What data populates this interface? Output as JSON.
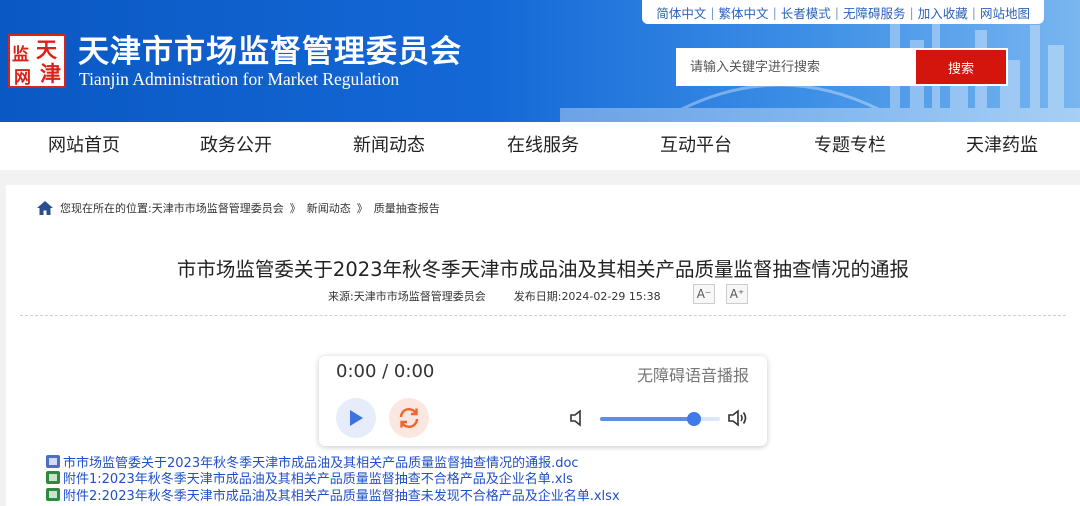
{
  "header": {
    "toplinks": [
      "简体中文",
      "繁体中文",
      "长者模式",
      "无障碍服务",
      "加入收藏",
      "网站地图"
    ],
    "logo_chars": [
      "天",
      "津",
      "监",
      "网"
    ],
    "site_title": "天津市市场监督管理委员会",
    "site_subtitle": "Tianjin Administration for Market Regulation",
    "search_placeholder": "请输入关键字进行搜索",
    "search_button": "搜索"
  },
  "nav": [
    "网站首页",
    "政务公开",
    "新闻动态",
    "在线服务",
    "互动平台",
    "专题专栏",
    "天津药监"
  ],
  "breadcrumb": {
    "prefix": "您现在所在的位置:",
    "items": [
      "天津市市场监督管理委员会",
      "新闻动态",
      "质量抽查报告"
    ],
    "separator": "》"
  },
  "article": {
    "title": "市市场监管委关于2023年秋冬季天津市成品油及其相关产品质量监督抽查情况的通报",
    "source_label": "来源:",
    "source": "天津市市场监督管理委员会",
    "date_label": "发布日期:",
    "date": "2024-02-29 15:38",
    "font_smaller": "A⁻",
    "font_larger": "A⁺"
  },
  "player": {
    "time": "0:00 / 0:00",
    "label": "无障碍语音播报",
    "volume": 0.78
  },
  "attachments": [
    {
      "type": "doc",
      "text": "市市场监管委关于2023年秋冬季天津市成品油及其相关产品质量监督抽查情况的通报.doc"
    },
    {
      "type": "xls",
      "text": "附件1:2023年秋冬季天津市成品油及其相关产品质量监督抽查不合格产品及企业名单.xls"
    },
    {
      "type": "xls",
      "text": "附件2:2023年秋冬季天津市成品油及其相关产品质量监督抽查未发现不合格产品及企业名单.xlsx"
    }
  ],
  "colors": {
    "header_blue": "#1468d6",
    "search_red": "#d3150e",
    "link_blue": "#1f4fc7",
    "logo_red": "#d9231a"
  }
}
